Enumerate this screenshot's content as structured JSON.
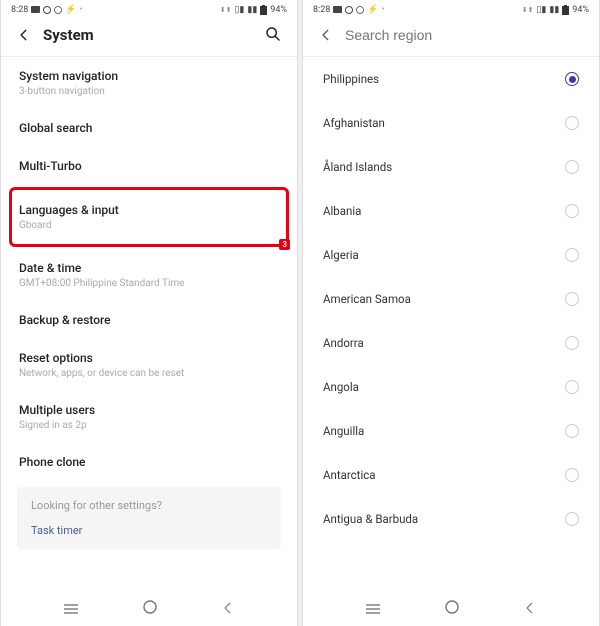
{
  "statusbar": {
    "time": "8:28",
    "battery": "94%"
  },
  "left": {
    "title": "System",
    "items": [
      {
        "label": "System navigation",
        "sub": "3-button navigation"
      },
      {
        "label": "Global search",
        "sub": ""
      },
      {
        "label": "Multi-Turbo",
        "sub": ""
      },
      {
        "label": "Languages & input",
        "sub": "Gboard",
        "highlight": true,
        "badge": "3"
      },
      {
        "label": "Date & time",
        "sub": "GMT+08:00 Philippine Standard Time"
      },
      {
        "label": "Backup & restore",
        "sub": ""
      },
      {
        "label": "Reset options",
        "sub": "Network, apps, or device can be reset"
      },
      {
        "label": "Multiple users",
        "sub": "Signed in as 2p"
      },
      {
        "label": "Phone clone",
        "sub": ""
      }
    ],
    "suggest": {
      "question": "Looking for other settings?",
      "link": "Task timer"
    }
  },
  "right": {
    "placeholder": "Search region",
    "regions": [
      {
        "name": "Philippines",
        "selected": true
      },
      {
        "name": "Afghanistan",
        "selected": false
      },
      {
        "name": "Åland Islands",
        "selected": false
      },
      {
        "name": "Albania",
        "selected": false
      },
      {
        "name": "Algeria",
        "selected": false
      },
      {
        "name": "American Samoa",
        "selected": false
      },
      {
        "name": "Andorra",
        "selected": false
      },
      {
        "name": "Angola",
        "selected": false
      },
      {
        "name": "Anguilla",
        "selected": false
      },
      {
        "name": "Antarctica",
        "selected": false
      },
      {
        "name": "Antigua & Barbuda",
        "selected": false
      }
    ]
  }
}
